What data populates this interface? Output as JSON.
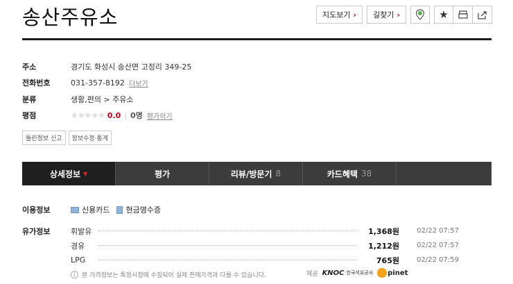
{
  "title": "송산주유소",
  "toolbar": {
    "map_label": "지도보기",
    "route_label": "길찾기"
  },
  "info": {
    "address_label": "주소",
    "address": "경기도 화성시 송산면 고정리 349-25",
    "phone_label": "전화번호",
    "phone": "031-357-8192",
    "phone_more": "더보기",
    "category_label": "분류",
    "category": "생활,편의 > 주유소",
    "rating_label": "평점",
    "stars": "★★★★★",
    "score": "0.0",
    "review_count": "0명",
    "rate_link": "평가하기"
  },
  "small_buttons": {
    "report": "틀린정보 신고",
    "edit": "정보수정·통계"
  },
  "tabs": [
    {
      "label": "상세정보",
      "count": "",
      "active": true
    },
    {
      "label": "평가",
      "count": ""
    },
    {
      "label": "리뷰/방문기",
      "count": "8"
    },
    {
      "label": "카드혜택",
      "count": "38"
    }
  ],
  "usage": {
    "label": "이용정보",
    "card": "신용카드",
    "receipt": "현금영수증"
  },
  "prices": {
    "label": "유가정보",
    "rows": [
      {
        "fuel": "휘발유",
        "price": "1,368원",
        "time": "02/22 07:57"
      },
      {
        "fuel": "경유",
        "price": "1,212원",
        "time": "02/22 07:57"
      },
      {
        "fuel": "LPG",
        "price": "765원",
        "time": "02/22 07:59"
      }
    ]
  },
  "notice": "본 가격정보는 특정시점에 수집되어 실제 판매가격과 다를 수 있습니다.",
  "provider": {
    "label": "제공",
    "knoc": "KNOC",
    "knoc_sub": "한국석유공사",
    "opinet": "pinet"
  },
  "colors": {
    "accent_red": "#d0021b",
    "tab_bg": "#3c3c3c",
    "tab_active_bg": "#1f1f1f"
  }
}
